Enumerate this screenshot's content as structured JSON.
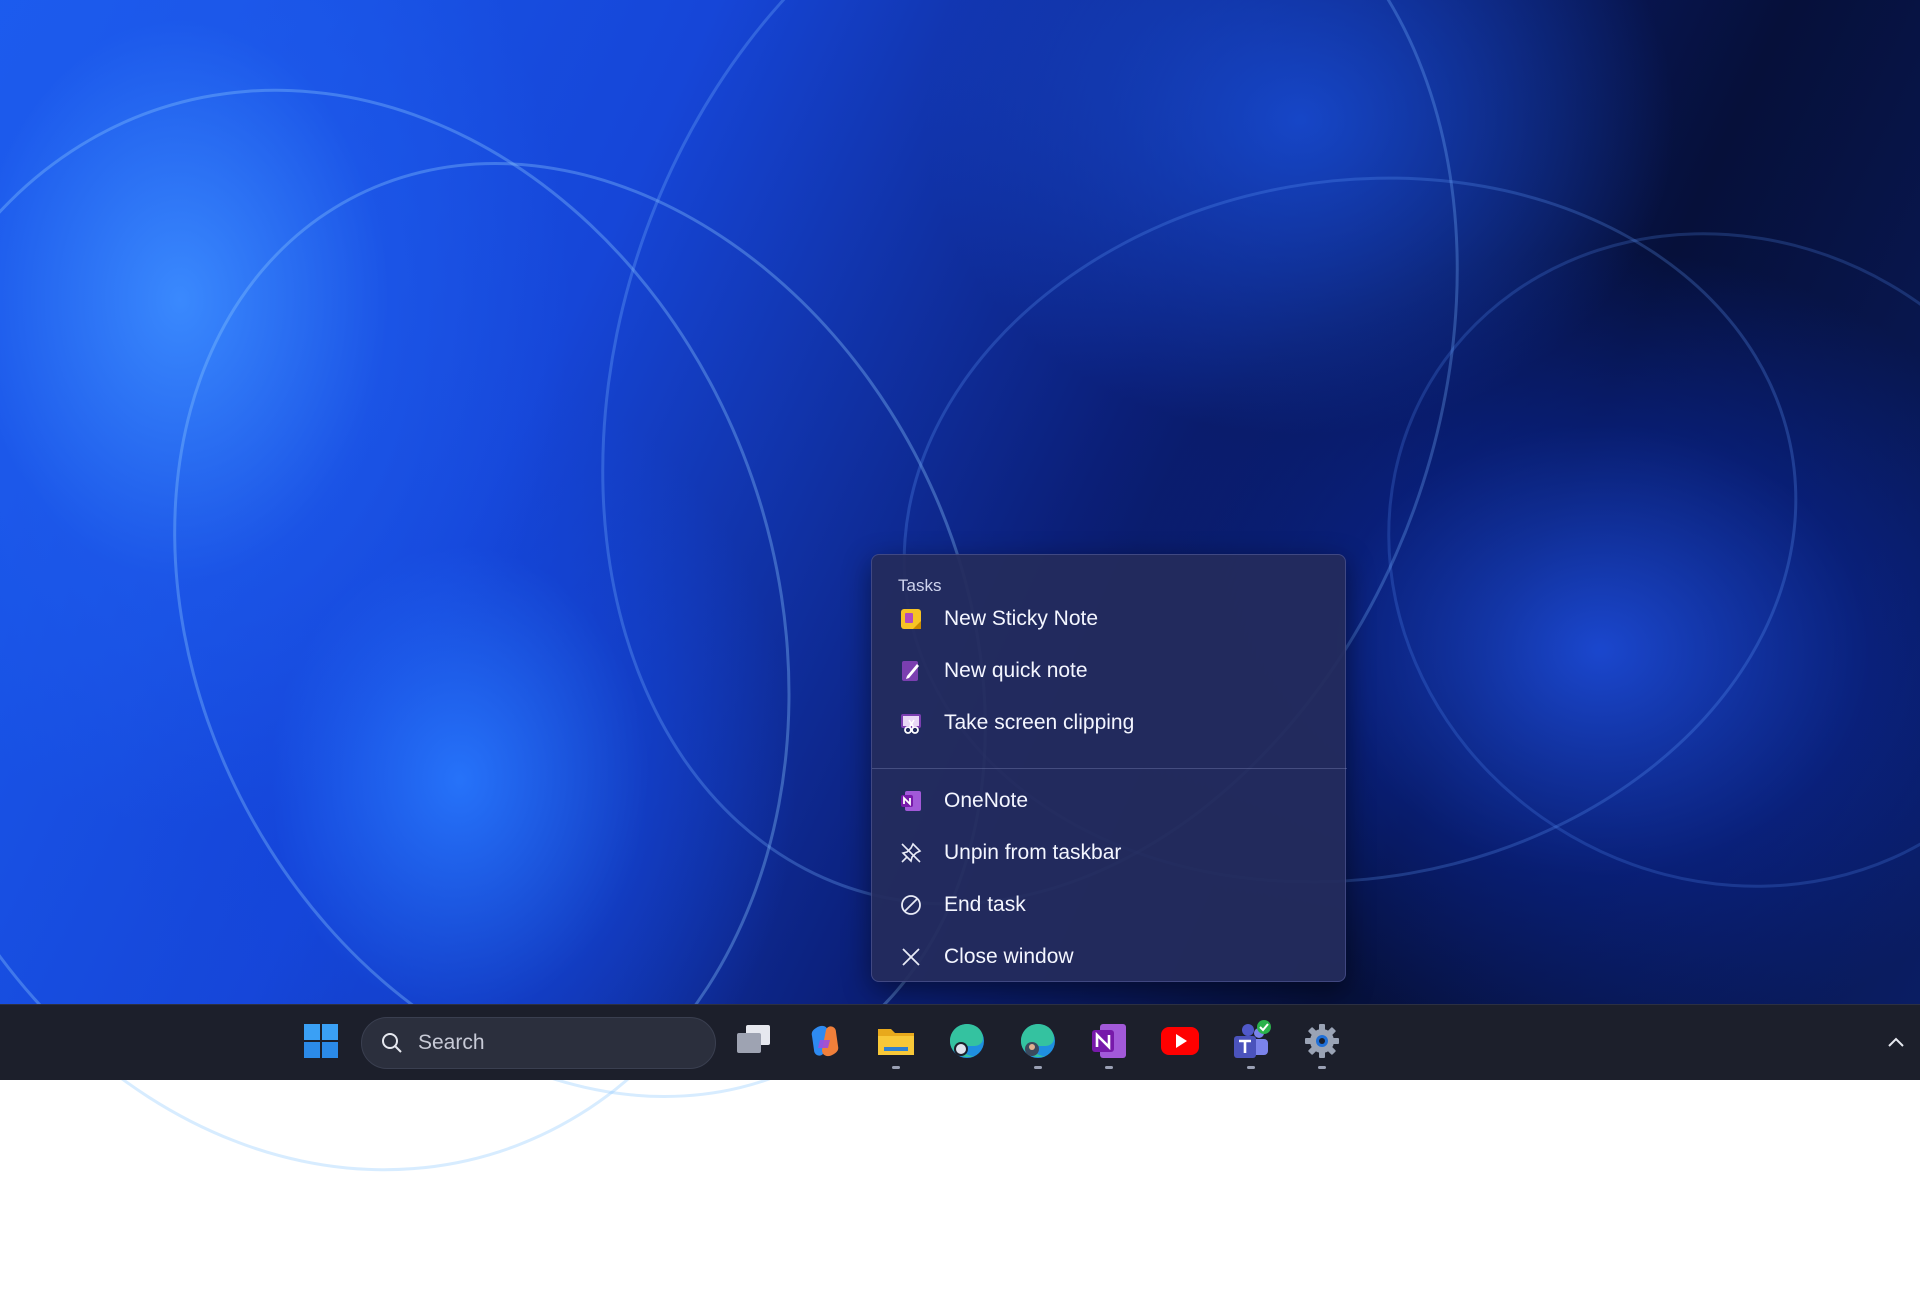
{
  "jumplist": {
    "section_title": "Tasks",
    "tasks": [
      {
        "label": "New Sticky Note",
        "icon": "sticky-note-icon"
      },
      {
        "label": "New quick note",
        "icon": "quick-note-icon"
      },
      {
        "label": "Take screen clipping",
        "icon": "screen-clipping-icon"
      }
    ],
    "actions": [
      {
        "label": "OneNote",
        "icon": "onenote-icon"
      },
      {
        "label": "Unpin from taskbar",
        "icon": "unpin-icon"
      },
      {
        "label": "End task",
        "icon": "end-task-icon"
      },
      {
        "label": "Close window",
        "icon": "close-icon"
      }
    ]
  },
  "taskbar": {
    "search_label": "Search",
    "apps": [
      {
        "name": "Start",
        "icon": "windows-start-icon"
      },
      {
        "name": "Task View",
        "icon": "task-view-icon"
      },
      {
        "name": "Copilot",
        "icon": "copilot-icon"
      },
      {
        "name": "File Explorer",
        "icon": "file-explorer-icon"
      },
      {
        "name": "Edge",
        "icon": "edge-icon"
      },
      {
        "name": "Edge Profile",
        "icon": "edge-profile-icon"
      },
      {
        "name": "OneNote",
        "icon": "onenote-icon"
      },
      {
        "name": "YouTube",
        "icon": "youtube-icon"
      },
      {
        "name": "Teams",
        "icon": "teams-icon"
      },
      {
        "name": "Settings",
        "icon": "settings-icon"
      }
    ]
  },
  "colors": {
    "accent": "#1a5cf0",
    "menu_bg": "#242c5c",
    "taskbar_bg": "#1c1f2b"
  }
}
